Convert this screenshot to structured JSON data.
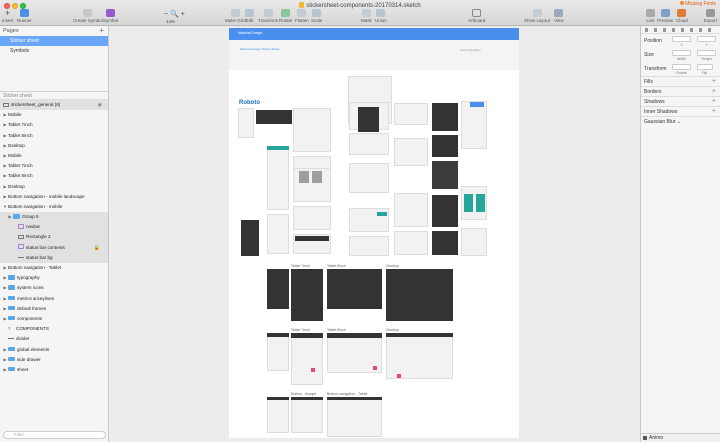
{
  "window": {
    "title": "stickersheet-components-20170314.sketch",
    "missing_fonts": "Missing Fonts"
  },
  "toolbar": {
    "insert": "Insert",
    "runner": "Runner",
    "create_symbol": "Create Symbol",
    "symbol": "Symbol",
    "zoom": "14%",
    "make_grid": "Make Grid",
    "edit": "Edit",
    "transform": "Transform",
    "rotate": "Rotate",
    "flatten": "Flatten",
    "scale": "Scale",
    "mask": "Mask",
    "union": "Union",
    "artboard": "Artboard",
    "show_layout": "Show Layout",
    "view": "View",
    "link": "Link",
    "preview": "Preview",
    "cloud": "Cloud",
    "export": "Export"
  },
  "pages": {
    "header": "Pages",
    "items": [
      "Sticker sheet",
      "Symbols"
    ]
  },
  "layers": {
    "header": "Sticker sheet",
    "artboard": "stickersheet_general (6)",
    "items": [
      {
        "label": "Mobile",
        "type": "artboard"
      },
      {
        "label": "Tablet 7inch",
        "type": "artboard"
      },
      {
        "label": "Tablet 8inch",
        "type": "artboard"
      },
      {
        "label": "Desktop",
        "type": "artboard"
      },
      {
        "label": "Mobile",
        "type": "artboard"
      },
      {
        "label": "Tablet 7inch",
        "type": "artboard"
      },
      {
        "label": "Tablet 8inch",
        "type": "artboard"
      },
      {
        "label": "Desktop",
        "type": "artboard"
      },
      {
        "label": "Bottom navigation - mobile landscape",
        "type": "artboard"
      },
      {
        "label": "Bottom navigation - mobile",
        "type": "artboard-open"
      },
      {
        "label": "Group 5",
        "type": "folder"
      },
      {
        "label": "navbar",
        "type": "symbol"
      },
      {
        "label": "Rectangle 2",
        "type": "rect"
      },
      {
        "label": "status bar contents",
        "type": "symbol"
      },
      {
        "label": "status bar bg",
        "type": "line"
      },
      {
        "label": "Bottom navigation - Tablet",
        "type": "artboard"
      },
      {
        "label": "typography",
        "type": "folder"
      },
      {
        "label": "system icons",
        "type": "folder"
      },
      {
        "label": "metrics & keylines",
        "type": "folder"
      },
      {
        "label": "default frames",
        "type": "folder"
      },
      {
        "label": "components",
        "type": "folder"
      },
      {
        "label": "COMPONENTS",
        "type": "text"
      },
      {
        "label": "divider",
        "type": "line"
      },
      {
        "label": "global elements",
        "type": "folder"
      },
      {
        "label": "side drawer",
        "type": "folder"
      },
      {
        "label": "sheet",
        "type": "folder"
      }
    ],
    "filter_placeholder": "Filter"
  },
  "canvas": {
    "header_text": "Material Design",
    "sub_left": "Material Design Sticker Sheet",
    "sub_right": "www.material.io",
    "roboto": "Roboto",
    "labels": {
      "tablet_7inch": "Tablet 7inch",
      "tablet_8inch": "Tablet 8inch",
      "desktop": "Desktop",
      "tablet_7inch_2": "Tablet 7inch",
      "tablet_8inch_2": "Tablet 8inch",
      "desktop_2": "Desktop",
      "bottom_landscape": "Bottom...dscape",
      "bottom_tablet": "Bottom navigation - Tablet"
    }
  },
  "inspector": {
    "position": "Position",
    "x": "X",
    "y": "Y",
    "size": "Size",
    "width": "Width",
    "height": "Height",
    "transform": "Transform",
    "rotate": "Rotate",
    "flip": "Flip",
    "fills": "Fills",
    "borders": "Borders",
    "shadows": "Shadows",
    "inner_shadows": "Inner Shadows",
    "gaussian_blur": "Gaussian Blur",
    "animo": "Animo"
  }
}
